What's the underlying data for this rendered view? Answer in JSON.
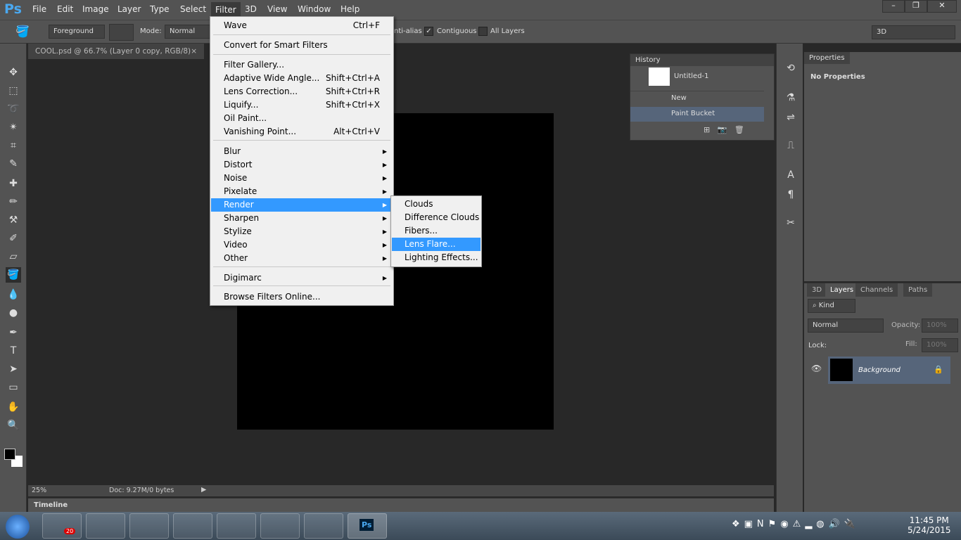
{
  "app": {
    "logo": "Ps"
  },
  "menubar": [
    "File",
    "Edit",
    "Image",
    "Layer",
    "Type",
    "Select",
    "Filter",
    "3D",
    "View",
    "Window",
    "Help"
  ],
  "window_controls": [
    "–",
    "❐",
    "✕"
  ],
  "options": {
    "fill_source": "Foreground",
    "mode_label": "Mode:",
    "mode": "Normal",
    "antialias": "nti-alias",
    "contiguous": "Contiguous",
    "contiguous_checked": true,
    "all_layers": "All Layers",
    "all_layers_checked": false,
    "workspace": "3D"
  },
  "document_tab": {
    "title": "COOL.psd @ 66.7% (Layer 0 copy, RGB/8)",
    "close": "×"
  },
  "status": {
    "zoom": "25%",
    "doc": "Doc: 9.27M/0 bytes"
  },
  "timeline": {
    "label": "Timeline"
  },
  "filter_menu": {
    "items": [
      {
        "label": "Wave",
        "shortcut": "Ctrl+F"
      },
      {
        "label": "Convert for Smart Filters"
      },
      {
        "label": "Filter Gallery..."
      },
      {
        "label": "Adaptive Wide Angle...",
        "shortcut": "Shift+Ctrl+A"
      },
      {
        "label": "Lens Correction...",
        "shortcut": "Shift+Ctrl+R"
      },
      {
        "label": "Liquify...",
        "shortcut": "Shift+Ctrl+X"
      },
      {
        "label": "Oil Paint..."
      },
      {
        "label": "Vanishing Point...",
        "shortcut": "Alt+Ctrl+V"
      },
      {
        "label": "Blur",
        "submenu": true
      },
      {
        "label": "Distort",
        "submenu": true
      },
      {
        "label": "Noise",
        "submenu": true
      },
      {
        "label": "Pixelate",
        "submenu": true
      },
      {
        "label": "Render",
        "submenu": true,
        "highlighted": true
      },
      {
        "label": "Sharpen",
        "submenu": true
      },
      {
        "label": "Stylize",
        "submenu": true
      },
      {
        "label": "Video",
        "submenu": true
      },
      {
        "label": "Other",
        "submenu": true
      },
      {
        "label": "Digimarc",
        "submenu": true
      },
      {
        "label": "Browse Filters Online..."
      }
    ]
  },
  "render_submenu": {
    "items": [
      "Clouds",
      "Difference Clouds",
      "Fibers...",
      "Lens Flare...",
      "Lighting Effects..."
    ],
    "highlighted": "Lens Flare..."
  },
  "history": {
    "title": "History",
    "snapshot": "Untitled-1",
    "states": [
      "New",
      "Paint Bucket"
    ],
    "selected": "Paint Bucket"
  },
  "properties": {
    "title": "Properties",
    "content": "No Properties"
  },
  "layers": {
    "tabs": [
      "3D",
      "Layers",
      "Channels",
      "Paths"
    ],
    "active_tab": "Layers",
    "filter": "Kind",
    "blend": "Normal",
    "opacity_label": "Opacity:",
    "opacity": "100%",
    "lock_label": "Lock:",
    "fill_label": "Fill:",
    "fill": "100%",
    "items": [
      {
        "name": "Background",
        "locked": true,
        "visible": true
      }
    ]
  },
  "taskbar": {
    "badge": "20",
    "time": "11:45 PM",
    "date": "5/24/2015"
  },
  "colors": {
    "accent": "#3399ff",
    "panel": "#535353",
    "selected_layer": "#56657a"
  }
}
